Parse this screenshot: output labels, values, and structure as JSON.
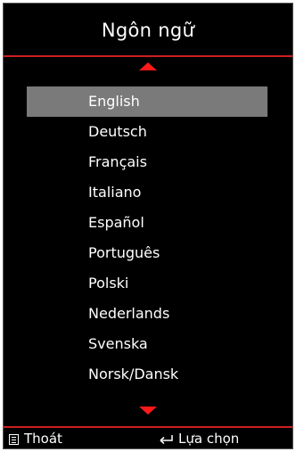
{
  "menu": {
    "title": "Ngôn ngữ",
    "languages": [
      "English",
      "Deutsch",
      "Français",
      "Italiano",
      "Español",
      "Português",
      "Polski",
      "Nederlands",
      "Svenska",
      "Norsk/Dansk"
    ],
    "selected_index": 0
  },
  "footer": {
    "exit_label": "Thoát",
    "exit_icon": "menu-icon",
    "select_label": "Lựa chọn",
    "select_icon": "enter-icon"
  },
  "colors": {
    "background": "#000000",
    "accent_red": "#cc1f1f",
    "arrow_red": "#ff1a1a",
    "selection": "#7a7a7a",
    "text": "#ffffff"
  }
}
